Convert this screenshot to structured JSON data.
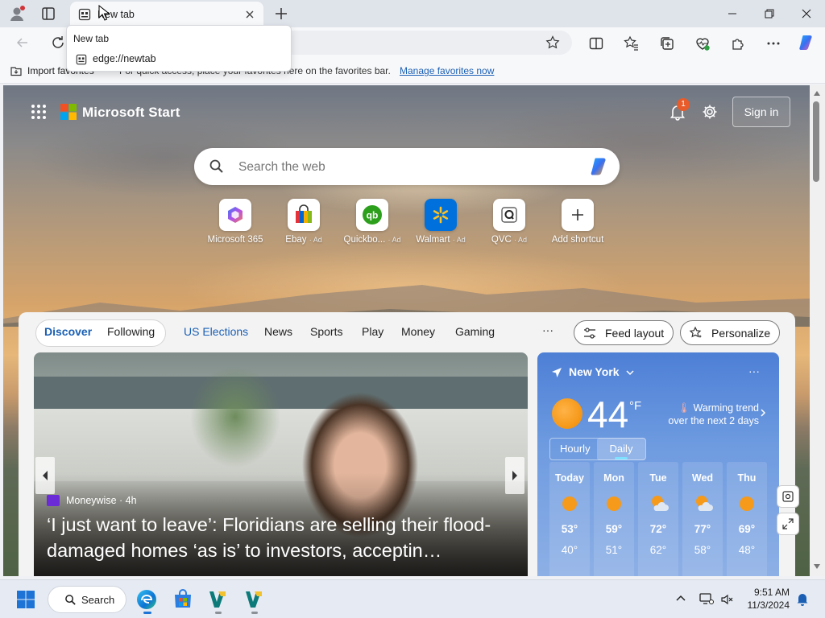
{
  "browser": {
    "tab_title": "New tab",
    "tooltip": {
      "title": "New tab",
      "url": "edge://newtab"
    },
    "favorites_bar": {
      "import_label": "Import favorites",
      "hint": "For quick access, place your favorites here on the favorites bar.",
      "manage_link": "Manage favorites now"
    }
  },
  "page": {
    "brand": "Microsoft Start",
    "notification_count": "1",
    "sign_in": "Sign in",
    "search_placeholder": "Search the web",
    "shortcuts": [
      {
        "label": "Microsoft 365",
        "ad": ""
      },
      {
        "label": "Ebay",
        "ad": "· Ad"
      },
      {
        "label": "Quickbo...",
        "ad": "· Ad"
      },
      {
        "label": "Walmart",
        "ad": "· Ad"
      },
      {
        "label": "QVC",
        "ad": "· Ad"
      },
      {
        "label": "Add shortcut",
        "ad": ""
      }
    ]
  },
  "feed": {
    "tabs": [
      "Discover",
      "Following",
      "US Elections",
      "News",
      "Sports",
      "Play",
      "Money",
      "Gaming"
    ],
    "more": "···",
    "feed_layout": "Feed layout",
    "personalize": "Personalize",
    "hero": {
      "source": "Moneywise · 4h",
      "headline": "‘I just want to leave’: Floridians are selling their flood-damaged homes ‘as is’ to investors, acceptin…"
    }
  },
  "weather": {
    "location": "New York",
    "more": "···",
    "temp": "44",
    "unit": "°F",
    "trend": "Warming trend over the next 2 days",
    "hourly": "Hourly",
    "daily": "Daily",
    "days": [
      {
        "day": "Today",
        "hi": "53°",
        "lo": "40°",
        "icon": "sun-icon"
      },
      {
        "day": "Mon",
        "hi": "59°",
        "lo": "51°",
        "icon": "sun-icon"
      },
      {
        "day": "Tue",
        "hi": "72°",
        "lo": "62°",
        "icon": "partly-cloudy-icon"
      },
      {
        "day": "Wed",
        "hi": "77°",
        "lo": "58°",
        "icon": "partly-cloudy-icon"
      },
      {
        "day": "Thu",
        "hi": "69°",
        "lo": "48°",
        "icon": "sun-icon"
      }
    ]
  },
  "taskbar": {
    "search_label": "Search",
    "time": "9:51 AM",
    "date": "11/3/2024"
  },
  "colors": {
    "accent": "#1a5fb4",
    "badge": "#e85b2a",
    "weather_bg": "#4d7fd6"
  }
}
